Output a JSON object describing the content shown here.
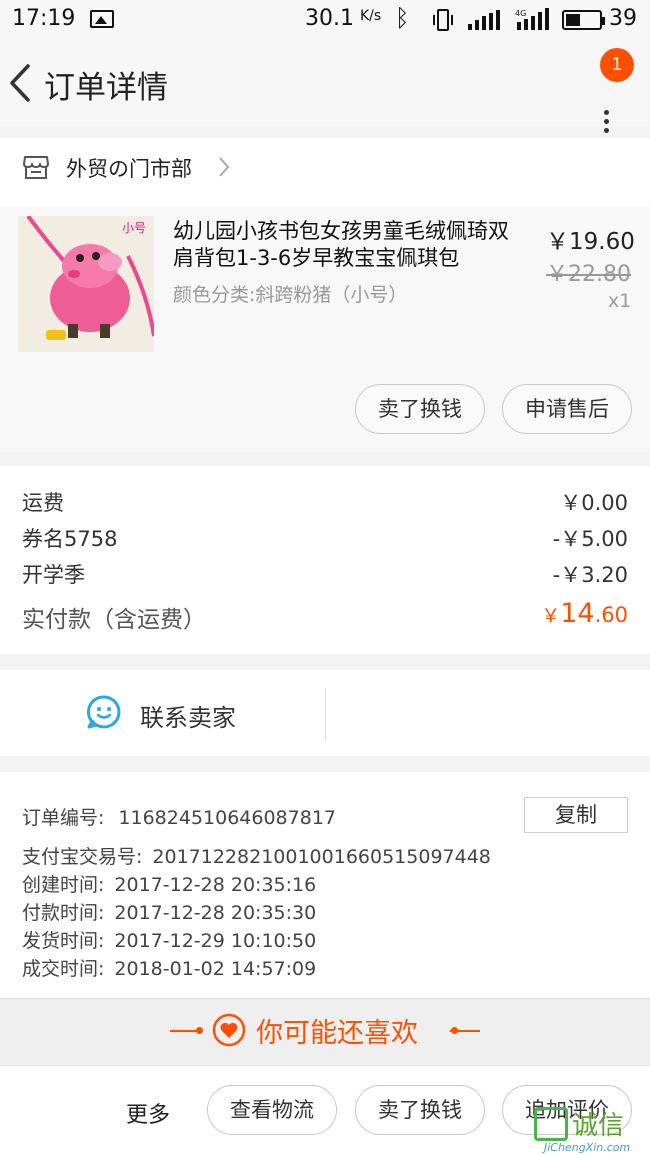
{
  "status_bar": {
    "time": "17:19",
    "speed": "30.1",
    "speed_unit": "K/s",
    "battery_percent": "39",
    "network": "4G"
  },
  "header": {
    "title": "订单详情",
    "notification_count": "1"
  },
  "shop": {
    "name": "外贸の门市部"
  },
  "item": {
    "title": "幼儿园小孩书包女孩男童毛绒佩琦双肩背包1-3-6岁早教宝宝佩琪包",
    "thumb_tag": "小号",
    "sku": "颜色分类:斜跨粉猪（小号）",
    "price": "￥19.60",
    "original_price": "￥22.80",
    "quantity": "x1",
    "buttons": {
      "resell": "卖了换钱",
      "after_sale": "申请售后"
    }
  },
  "fees": {
    "rows": [
      {
        "label": "运费",
        "value": "￥0.00"
      },
      {
        "label": "券名5758",
        "value": "-￥5.00"
      },
      {
        "label": "开学季",
        "value": "-￥3.20"
      }
    ],
    "paid_label": "实付款（含运费）",
    "paid_currency": "￥",
    "paid_int": "14",
    "paid_dec": ".60"
  },
  "contact": {
    "label": "联系卖家"
  },
  "order_info": {
    "order_no_label": "订单编号:",
    "order_no": "116824510646087817",
    "copy_label": "复制",
    "alipay_label": "支付宝交易号:",
    "alipay_no": "2017122821001001660515097448",
    "created_label": "创建时间:",
    "created": "2017-12-28 20:35:16",
    "paid_label": "付款时间:",
    "paid": "2017-12-28 20:35:30",
    "shipped_label": "发货时间:",
    "shipped": "2017-12-29 10:10:50",
    "closed_label": "成交时间:",
    "closed": "2018-01-02 14:57:09"
  },
  "recommend": {
    "label": "你可能还喜欢"
  },
  "bottom_bar": {
    "more": "更多",
    "logistics": "查看物流",
    "resell": "卖了换钱",
    "review": "追加评价"
  },
  "watermark": {
    "text": "诚信",
    "url": "JiChengXin.com"
  },
  "colors": {
    "accent": "#ff5000",
    "contact_icon": "#2da7e0"
  }
}
